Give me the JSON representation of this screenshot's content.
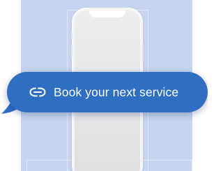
{
  "cta": {
    "label": "Book your next service",
    "icon": "link-icon"
  },
  "colors": {
    "background_panel": "#c7d4ef",
    "bubble": "#2f6fc1",
    "bubble_text": "#ffffff",
    "phone_body": "#f5f5f7"
  }
}
